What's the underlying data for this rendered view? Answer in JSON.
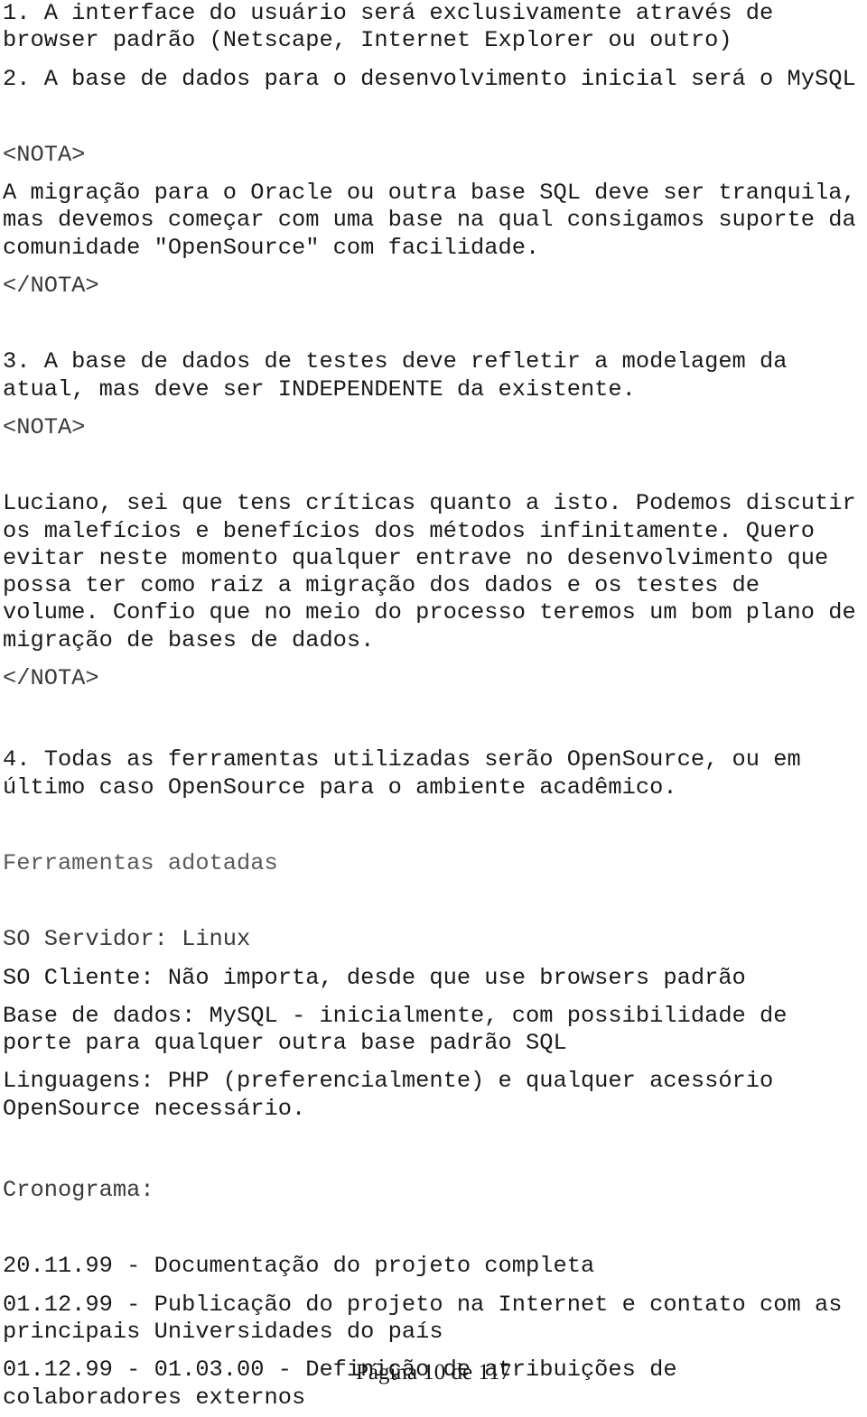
{
  "document": {
    "page_label": "Página 10 de 117",
    "blocks": [
      {
        "id": "item1",
        "tone": "dark",
        "lines": [
          "1. A interface do usuário será exclusivamente através de",
          "browser padrão (Netscape, Internet Explorer ou outro)"
        ]
      },
      {
        "id": "item2",
        "tone": "dark",
        "lines": [
          "2. A base de dados para o desenvolvimento inicial será o MySQL"
        ]
      },
      {
        "id": "nota1-open",
        "tone": "mid",
        "lines": [
          "<NOTA>"
        ]
      },
      {
        "id": "nota1-body",
        "tone": "dark",
        "lines": [
          "A migração para o Oracle ou outra base SQL deve ser tranquila,",
          "mas devemos começar com uma base na qual consigamos suporte da",
          "comunidade \"OpenSource\" com facilidade."
        ]
      },
      {
        "id": "nota1-close",
        "tone": "mid",
        "lines": [
          "</NOTA>"
        ]
      },
      {
        "id": "item3",
        "tone": "dark",
        "lines": [
          "3. A base de dados de testes deve refletir a modelagem da",
          "atual, mas deve ser INDEPENDENTE da existente."
        ]
      },
      {
        "id": "nota2-open",
        "tone": "mid",
        "lines": [
          "<NOTA>"
        ]
      },
      {
        "id": "nota2-body",
        "tone": "dark",
        "lines": [
          "Luciano, sei que tens críticas quanto a isto. Podemos discutir",
          "os malefícios e benefícios dos métodos infinitamente. Quero",
          "evitar neste momento qualquer entrave no desenvolvimento que",
          "possa ter como raiz a migração dos dados e os testes de",
          "volume. Confio que no meio do processo teremos um bom plano de",
          "migração de bases de dados."
        ]
      },
      {
        "id": "nota2-close",
        "tone": "mid",
        "lines": [
          "</NOTA>"
        ]
      },
      {
        "id": "item4",
        "tone": "dark",
        "lines": [
          "4. Todas as ferramentas utilizadas serão OpenSource, ou em",
          "último caso OpenSource para o ambiente acadêmico."
        ]
      },
      {
        "id": "heading-ferramentas",
        "tone": "light",
        "lines": [
          "Ferramentas adotadas"
        ]
      },
      {
        "id": "so-servidor",
        "tone": "mid",
        "lines": [
          "SO Servidor: Linux"
        ]
      },
      {
        "id": "so-cliente",
        "tone": "dark",
        "lines": [
          "SO Cliente: Não importa, desde que use browsers padrão"
        ]
      },
      {
        "id": "base-de-dados",
        "tone": "dark",
        "lines": [
          "Base de dados: MySQL - inicialmente, com possibilidade de",
          "porte para qualquer outra base padrão SQL"
        ]
      },
      {
        "id": "linguagens",
        "tone": "dark",
        "lines": [
          "Linguagens: PHP (preferencialmente) e qualquer acessório",
          "OpenSource necessário."
        ]
      },
      {
        "id": "heading-cronograma",
        "tone": "mid",
        "lines": [
          "Cronograma:"
        ]
      },
      {
        "id": "crono-1",
        "tone": "dark",
        "lines": [
          "20.11.99 - Documentação do projeto completa"
        ]
      },
      {
        "id": "crono-2",
        "tone": "dark",
        "lines": [
          "01.12.99 - Publicação do projeto na Internet e contato com as",
          "principais Universidades do país"
        ]
      },
      {
        "id": "crono-3",
        "tone": "dark",
        "lines": [
          "01.12.99 - 01.03.00 - Definição de atribuições de",
          "colaboradores externos"
        ]
      }
    ],
    "spacing_after": [
      "sm",
      "lg",
      "sm",
      "sm",
      "lg",
      "sm",
      "lg",
      "sm",
      "xl",
      "lg",
      "lg",
      "sm",
      "sm",
      "sm",
      "xl",
      "lg",
      "sm",
      "sm",
      "xs"
    ]
  }
}
